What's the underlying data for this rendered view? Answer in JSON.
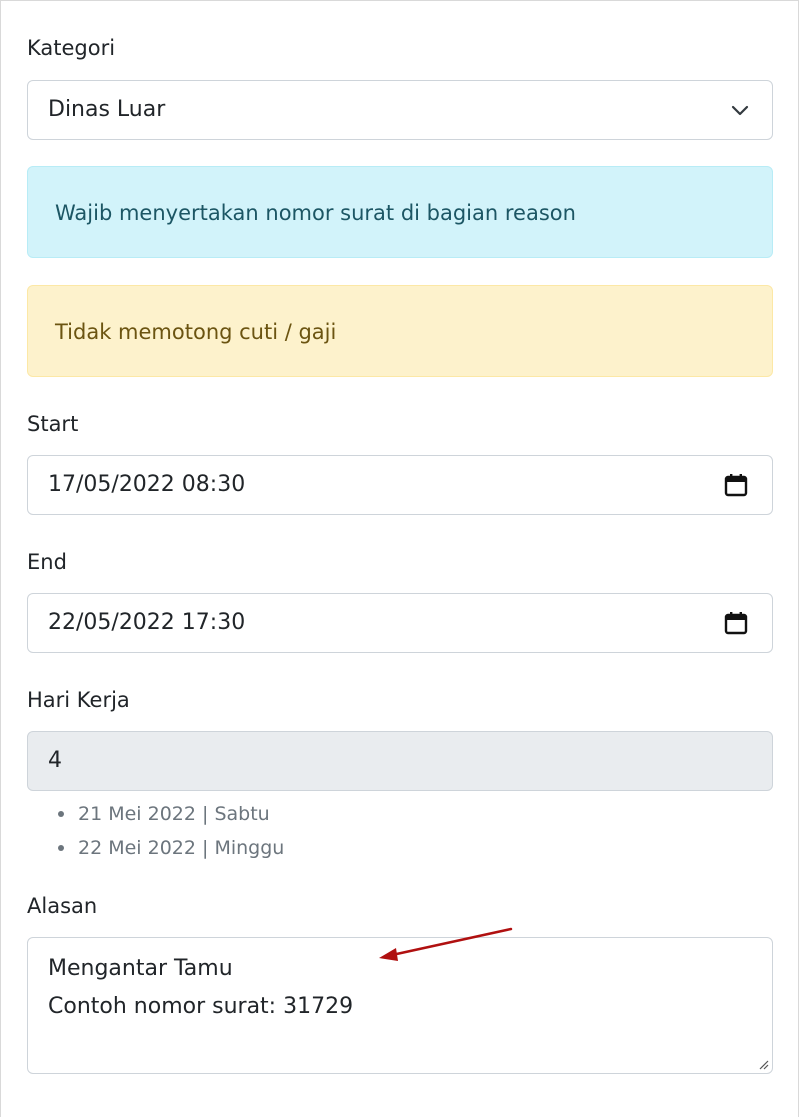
{
  "form": {
    "kategori": {
      "label": "Kategori",
      "selected": "Dinas Luar"
    },
    "alerts": {
      "info": "Wajib menyertakan nomor surat di bagian reason",
      "warning": "Tidak memotong cuti / gaji"
    },
    "start": {
      "label": "Start",
      "value": "17/05/2022 08:30"
    },
    "end": {
      "label": "End",
      "value": "22/05/2022 17:30"
    },
    "hari_kerja": {
      "label": "Hari Kerja",
      "value": "4",
      "excluded_dates": [
        "21 Mei 2022 | Sabtu",
        "22 Mei 2022 | Minggu"
      ]
    },
    "alasan": {
      "label": "Alasan",
      "lines": [
        "Mengantar Tamu",
        "Contoh nomor surat: 31729"
      ]
    }
  },
  "colors": {
    "info_bg": "#d2f3fa",
    "warning_bg": "#fdf2cc",
    "annotation_arrow": "#b01010"
  },
  "icons": {
    "select": "chevron-down-icon",
    "datetime": "calendar-icon",
    "annotation": "red-arrow-annotation"
  }
}
